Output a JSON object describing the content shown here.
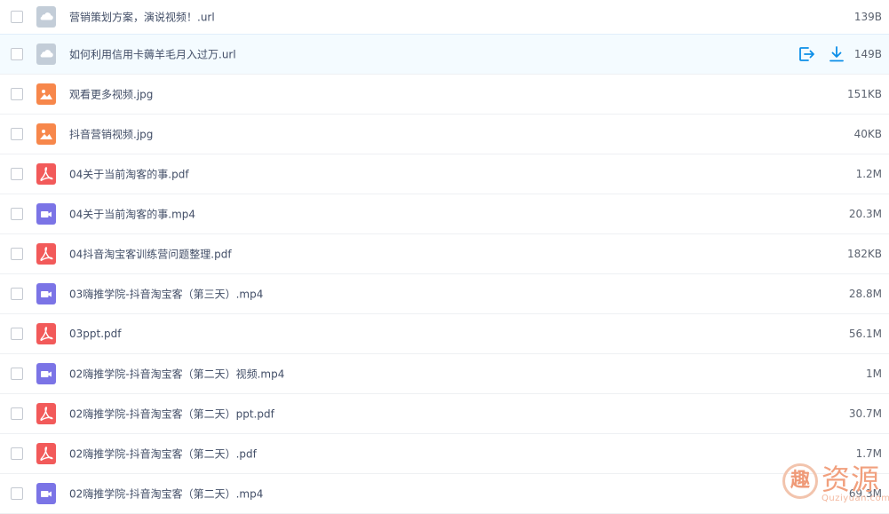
{
  "files": [
    {
      "name": "营销策划方案，演说视频！.url",
      "size": "139B",
      "type": "url",
      "icon": "cloud-link-icon"
    },
    {
      "name": "如何利用信用卡薅羊毛月入过万.url",
      "size": "149B",
      "type": "url",
      "icon": "cloud-link-icon",
      "hovered": true
    },
    {
      "name": "观看更多视频.jpg",
      "size": "151KB",
      "type": "image",
      "icon": "image-file-icon"
    },
    {
      "name": "抖音营销视频.jpg",
      "size": "40KB",
      "type": "image",
      "icon": "image-file-icon"
    },
    {
      "name": "04关于当前淘客的事.pdf",
      "size": "1.2M",
      "type": "pdf",
      "icon": "pdf-file-icon"
    },
    {
      "name": "04关于当前淘客的事.mp4",
      "size": "20.3M",
      "type": "video",
      "icon": "video-file-icon"
    },
    {
      "name": "04抖音淘宝客训练营问题整理.pdf",
      "size": "182KB",
      "type": "pdf",
      "icon": "pdf-file-icon"
    },
    {
      "name": "03嗨推学院-抖音淘宝客（第三天）.mp4",
      "size": "28.8M",
      "type": "video",
      "icon": "video-file-icon"
    },
    {
      "name": "03ppt.pdf",
      "size": "56.1M",
      "type": "pdf",
      "icon": "pdf-file-icon"
    },
    {
      "name": "02嗨推学院-抖音淘宝客（第二天）视频.mp4",
      "size": "1M",
      "type": "video",
      "icon": "video-file-icon"
    },
    {
      "name": "02嗨推学院-抖音淘宝客（第二天）ppt.pdf",
      "size": "30.7M",
      "type": "pdf",
      "icon": "pdf-file-icon"
    },
    {
      "name": "02嗨推学院-抖音淘宝客（第二天）.pdf",
      "size": "1.7M",
      "type": "pdf",
      "icon": "pdf-file-icon"
    },
    {
      "name": "02嗨推学院-抖音淘宝客（第二天）.mp4",
      "size": "69.3M",
      "type": "video",
      "icon": "video-file-icon"
    }
  ],
  "row_actions": {
    "share_icon": "share-icon",
    "download_icon": "download-icon"
  },
  "watermark": {
    "glyph": "趣",
    "text": "资源",
    "sub": "Quziyuan.com"
  },
  "colors": {
    "url": "#c3cdd8",
    "image": "#f7874b",
    "pdf": "#f25a5a",
    "video": "#7b74e6",
    "accent": "#0c8ee8",
    "hover_bg": "#f4fbff"
  }
}
